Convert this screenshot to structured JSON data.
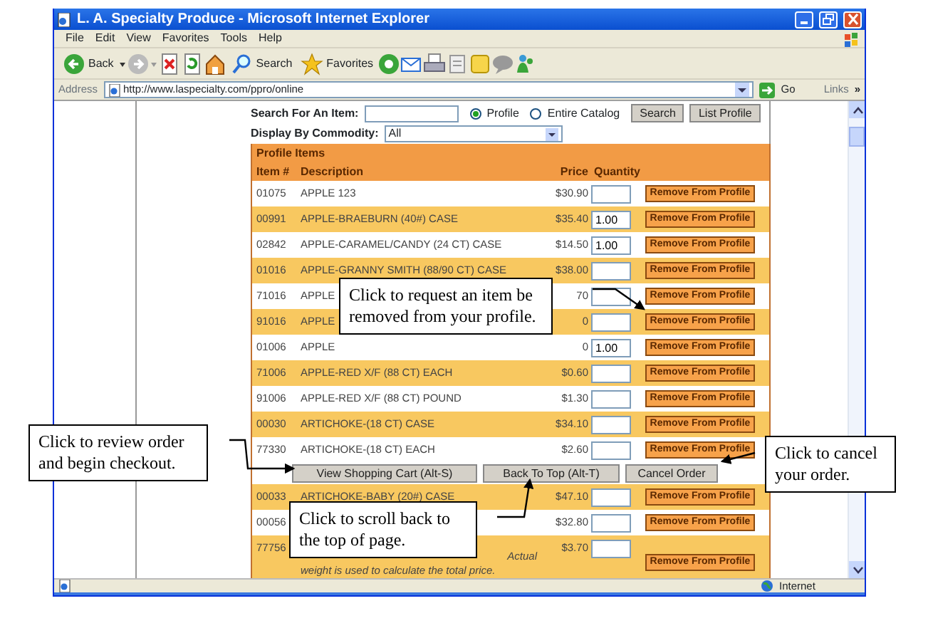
{
  "window": {
    "title": "L. A. Specialty Produce - Microsoft Internet Explorer"
  },
  "menu": [
    "File",
    "Edit",
    "View",
    "Favorites",
    "Tools",
    "Help"
  ],
  "toolbar": {
    "back": "Back",
    "search": "Search",
    "favorites": "Favorites"
  },
  "address": {
    "label": "Address",
    "url": "http://www.laspecialty.com/ppro/online",
    "go": "Go",
    "links": "Links",
    "more": "»"
  },
  "search": {
    "label": "Search For An Item:",
    "options": [
      {
        "label": "Profile",
        "selected": true
      },
      {
        "label": "Entire Catalog",
        "selected": false
      }
    ],
    "buttons": [
      "Search",
      "List Profile"
    ]
  },
  "commodity": {
    "label": "Display By Commodity:",
    "value": "All"
  },
  "table": {
    "title": "Profile Items",
    "columns": [
      "Item #",
      "Description",
      "Price",
      "Quantity"
    ],
    "rows": [
      {
        "kind": "item",
        "item": "01075",
        "description": "APPLE 123",
        "price": "$30.90",
        "button": "Remove From Profile"
      },
      {
        "kind": "item",
        "item": "00991",
        "description": "APPLE-BRAEBURN (40#) CASE",
        "price": "$35.40",
        "quantity": "1.00",
        "button": "Remove From Profile"
      },
      {
        "kind": "item",
        "item": "02842",
        "description": "APPLE-CARAMEL/CANDY (24 CT) CASE",
        "price": "$14.50",
        "quantity": "1.00",
        "button": "Remove From Profile"
      },
      {
        "kind": "item",
        "item": "01016",
        "description": "APPLE-GRANNY SMITH (88/90 CT) CASE",
        "price": "$38.00",
        "button": "Remove From Profile"
      },
      {
        "kind": "item",
        "item": "71016",
        "description": "APPLE",
        "price": "70",
        "button": "Remove From Profile"
      },
      {
        "kind": "item",
        "item": "91016",
        "description": "APPLE",
        "price": "0",
        "button": "Remove From Profile"
      },
      {
        "kind": "item",
        "item": "01006",
        "description": "APPLE",
        "price": "0",
        "quantity": "1.00",
        "button": "Remove From Profile"
      },
      {
        "kind": "item",
        "item": "71006",
        "description": "APPLE-RED X/F (88 CT) EACH",
        "price": "$0.60",
        "button": "Remove From Profile"
      },
      {
        "kind": "item",
        "item": "91006",
        "description": "APPLE-RED X/F (88 CT) POUND",
        "price": "$1.30",
        "button": "Remove From Profile"
      },
      {
        "kind": "item",
        "item": "00030",
        "description": "ARTICHOKE-(18 CT) CASE",
        "price": "$34.10",
        "button": "Remove From Profile"
      },
      {
        "kind": "item",
        "item": "77330",
        "description": "ARTICHOKE-(18 CT) EACH",
        "price": "$2.60",
        "button": "Remove From Profile"
      },
      {
        "kind": "actions",
        "buttons": [
          "View Shopping Cart (Alt-S)",
          "Back To Top (Alt-T)",
          "Cancel Order"
        ]
      },
      {
        "kind": "item",
        "item": "00033",
        "description": "ARTICHOKE-BABY (20#) CASE",
        "price": "$47.10",
        "button": "Remove From Profile"
      },
      {
        "kind": "item",
        "item": "00056",
        "price": "$32.80",
        "button": "Remove From Profile"
      },
      {
        "kind": "item",
        "item": "77756",
        "price": "$3.70",
        "note": [
          "Actual",
          "weight is used to calculate the total price."
        ],
        "button": "Remove From Profile"
      }
    ]
  },
  "status_bar": {
    "zone": "Internet"
  },
  "callouts": [
    "Click to request an item be removed from your profile.",
    "Click to review order and begin checkout.",
    "Click to cancel your order.",
    "Click to scroll back to the top of page."
  ]
}
